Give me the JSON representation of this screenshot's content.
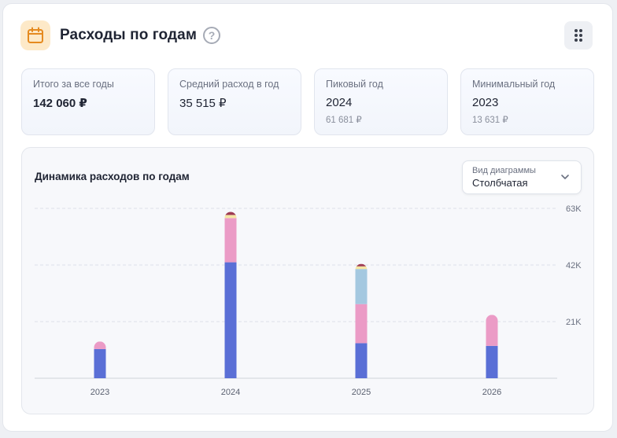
{
  "header": {
    "title": "Расходы по годам",
    "help": "?"
  },
  "stats": [
    {
      "label": "Итого за все годы",
      "value": "142 060 ₽",
      "sub": ""
    },
    {
      "label": "Средний расход в год",
      "value": "35 515 ₽",
      "sub": ""
    },
    {
      "label": "Пиковый год",
      "value": "2024",
      "sub": "61 681 ₽"
    },
    {
      "label": "Минимальный год",
      "value": "2023",
      "sub": "13 631 ₽"
    }
  ],
  "chart": {
    "title": "Динамика расходов по годам",
    "selector": {
      "label": "Вид диаграммы",
      "value": "Столбчатая"
    }
  },
  "colors": {
    "accent_icon_bg": "#fde9c8",
    "accent_icon": "#e58a1f"
  },
  "chart_data": {
    "type": "bar",
    "stacked": true,
    "categories": [
      "2023",
      "2024",
      "2025",
      "2026"
    ],
    "y_ticks": [
      "21K",
      "42K",
      "63K"
    ],
    "ylim": [
      0,
      63000
    ],
    "grid": true,
    "y_axis_side": "right",
    "series": [
      {
        "color": "#5a6fd6",
        "values": [
          10800,
          43000,
          13000,
          12000
        ]
      },
      {
        "color": "#eb9bc6",
        "values": [
          2831,
          16400,
          14500,
          11500
        ]
      },
      {
        "color": "#a4c8e0",
        "values": [
          0,
          0,
          13000,
          0
        ]
      },
      {
        "color": "#f5e6a3",
        "values": [
          0,
          1150,
          1000,
          0
        ]
      },
      {
        "color": "#9e3b52",
        "values": [
          0,
          1131,
          900,
          0
        ]
      }
    ]
  }
}
